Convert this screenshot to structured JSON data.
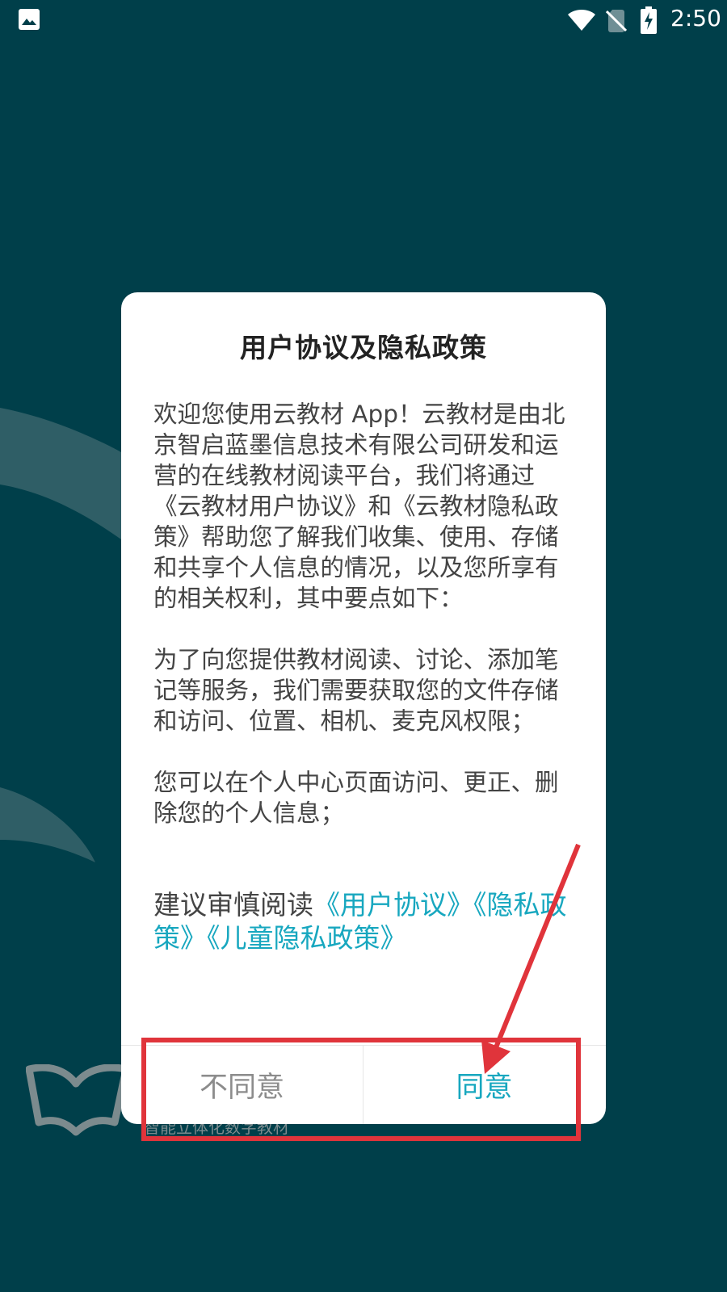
{
  "status_bar": {
    "time": "2:50",
    "icons": [
      "photo-icon",
      "wifi-icon",
      "no-sim-icon",
      "battery-charging-icon"
    ]
  },
  "splash": {
    "slogan": "智能立体化数字教材"
  },
  "dialog": {
    "title": "用户协议及隐私政策",
    "paragraph1": "欢迎您使用云教材 App！云教材是由北京智启蓝墨信息技术有限公司研发和运营的在线教材阅读平台，我们将通过《云教材用户协议》和《云教材隐私政策》帮助您了解我们收集、使用、存储和共享个人信息的情况，以及您所享有的相关权利，其中要点如下：",
    "paragraph2": "为了向您提供教材阅读、讨论、添加笔记等服务，我们需要获取您的文件存储和访问、位置、相机、麦克风权限；",
    "paragraph3": "您可以在个人中心页面访问、更正、删除您的个人信息；",
    "advice_prefix": "建议审慎阅读",
    "link_user_agreement": "《用户协议》",
    "link_privacy_policy": "《隐私政策》",
    "link_children_privacy": "《儿童隐私政策》",
    "disagree_label": "不同意",
    "agree_label": "同意"
  },
  "colors": {
    "background": "#003f4a",
    "accent": "#17a7bf",
    "annotation": "#e0343b"
  }
}
